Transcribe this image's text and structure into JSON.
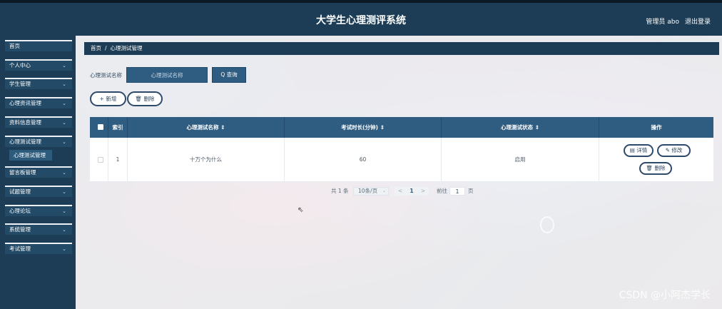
{
  "header": {
    "title": "大学生心理测评系统",
    "user": "管理员 abo",
    "logout": "退出登录"
  },
  "sidebar": {
    "items": [
      {
        "label": "首页",
        "chevron": ""
      },
      {
        "label": "个人中心",
        "chevron": "⌄"
      },
      {
        "label": "学生管理",
        "chevron": "⌄"
      },
      {
        "label": "心理资讯管理",
        "chevron": "⌄"
      },
      {
        "label": "资料信息管理",
        "chevron": "⌄"
      },
      {
        "label": "心理测试管理",
        "chevron": "⌄"
      },
      {
        "label": "留言板管理",
        "chevron": "⌄"
      },
      {
        "label": "试题管理",
        "chevron": "⌄"
      },
      {
        "label": "心理论坛",
        "chevron": "⌄"
      },
      {
        "label": "系统管理",
        "chevron": "⌄"
      },
      {
        "label": "考试管理",
        "chevron": "⌄"
      }
    ],
    "active_sub": "心理测试管理"
  },
  "breadcrumb": {
    "home": "首页",
    "separator": "/",
    "current": "心理测试管理"
  },
  "search": {
    "label": "心理测试名称",
    "placeholder": "心理测试名称",
    "button": "Q 查询"
  },
  "actions": {
    "add": "+ 新增",
    "delete": "🗑 删除"
  },
  "table": {
    "headers": [
      "",
      "索引",
      "心理测试名称 ⇕",
      "考试时长(分钟) ⇕",
      "心理测试状态 ⇕",
      "操作"
    ],
    "rows": [
      {
        "index": "1",
        "name": "十万个为什么",
        "duration": "60",
        "status": "启用"
      }
    ],
    "row_actions": {
      "detail": "▤ 详情",
      "edit": "✎ 修改",
      "delete": "🗑 删除"
    }
  },
  "pagination": {
    "total": "共 1 条",
    "page_size": "10条/页",
    "prev": "<",
    "current": "1",
    "next": ">",
    "goto_label": "前往",
    "goto_value": "1",
    "goto_unit": "页"
  },
  "watermark": "CSDN @小阿杰学长",
  "colors": {
    "primary": "#1c3d55",
    "accent": "#2f5d82",
    "sidebar": "#234a66"
  }
}
